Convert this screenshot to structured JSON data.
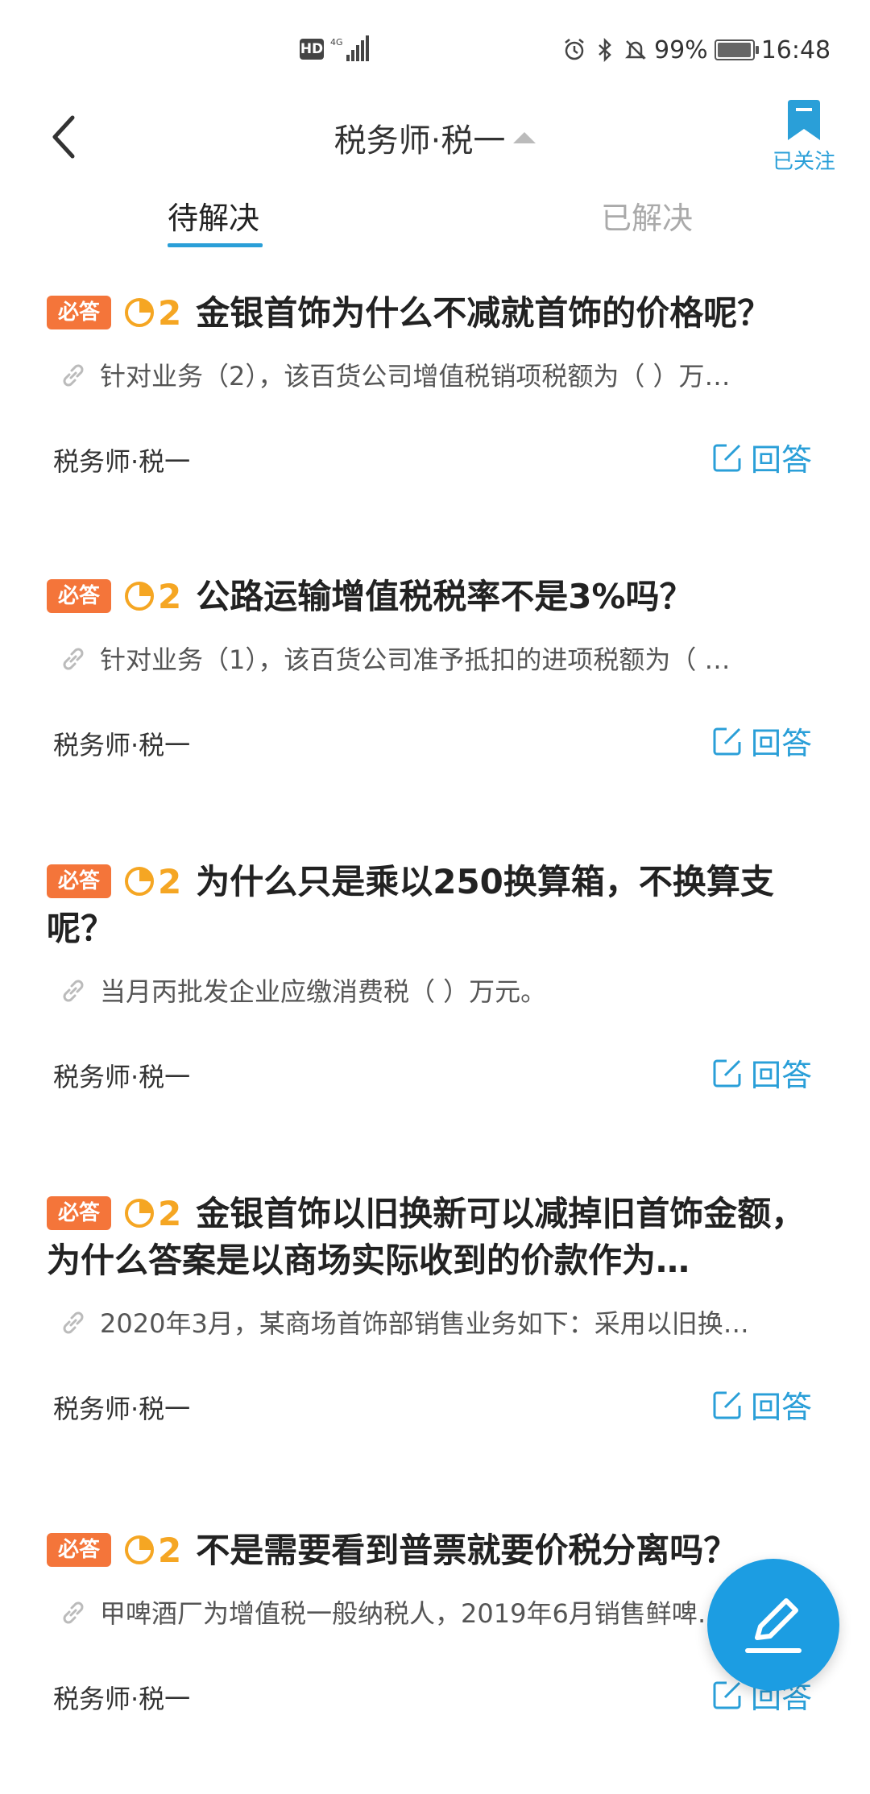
{
  "status_bar": {
    "network_label": "HD",
    "signal_label": "4G",
    "battery_percent": "99%",
    "battery_level": 0.99,
    "time": "16:48"
  },
  "header": {
    "title": "税务师·税一",
    "follow_label": "已关注"
  },
  "tabs": [
    {
      "label": "待解决",
      "active": true
    },
    {
      "label": "已解决",
      "active": false
    }
  ],
  "questions": [
    {
      "badge": "必答",
      "reward": "2",
      "title": "金银首饰为什么不减就首饰的价格呢？",
      "reference": "针对业务（2），该百货公司增值税销项税额为（ ）万…",
      "author": "税务师·税一",
      "answer_label": "回答"
    },
    {
      "badge": "必答",
      "reward": "2",
      "title": "公路运输增值税税率不是3%吗？",
      "reference": "针对业务（1），该百货公司准予抵扣的进项税额为（ …",
      "author": "税务师·税一",
      "answer_label": "回答"
    },
    {
      "badge": "必答",
      "reward": "2",
      "title": "为什么只是乘以250换算箱，不换算支呢？",
      "reference": "当月丙批发企业应缴消费税（ ）万元。",
      "author": "税务师·税一",
      "answer_label": "回答"
    },
    {
      "badge": "必答",
      "reward": "2",
      "title": "金银首饰以旧换新可以减掉旧首饰金额，为什么答案是以商场实际收到的价款作为…",
      "reference": "2020年3月，某商场首饰部销售业务如下：采用以旧换…",
      "author": "税务师·税一",
      "answer_label": "回答"
    },
    {
      "badge": "必答",
      "reward": "2",
      "title": "不是需要看到普票就要价税分离吗？",
      "reference": "甲啤酒厂为增值税一般纳税人，2019年6月销售鲜啤…",
      "author": "税务师·税一",
      "answer_label": "回答"
    }
  ],
  "colors": {
    "accent": "#2a9fd8",
    "badge": "#f4753a",
    "coin": "#f5a623",
    "fab": "#1c9de2"
  },
  "icons": {
    "back": "chevron-left-icon",
    "follow": "bookmark-icon",
    "coin": "coin-icon",
    "reference": "link-icon",
    "answer": "edit-icon",
    "fab": "pencil-icon"
  }
}
